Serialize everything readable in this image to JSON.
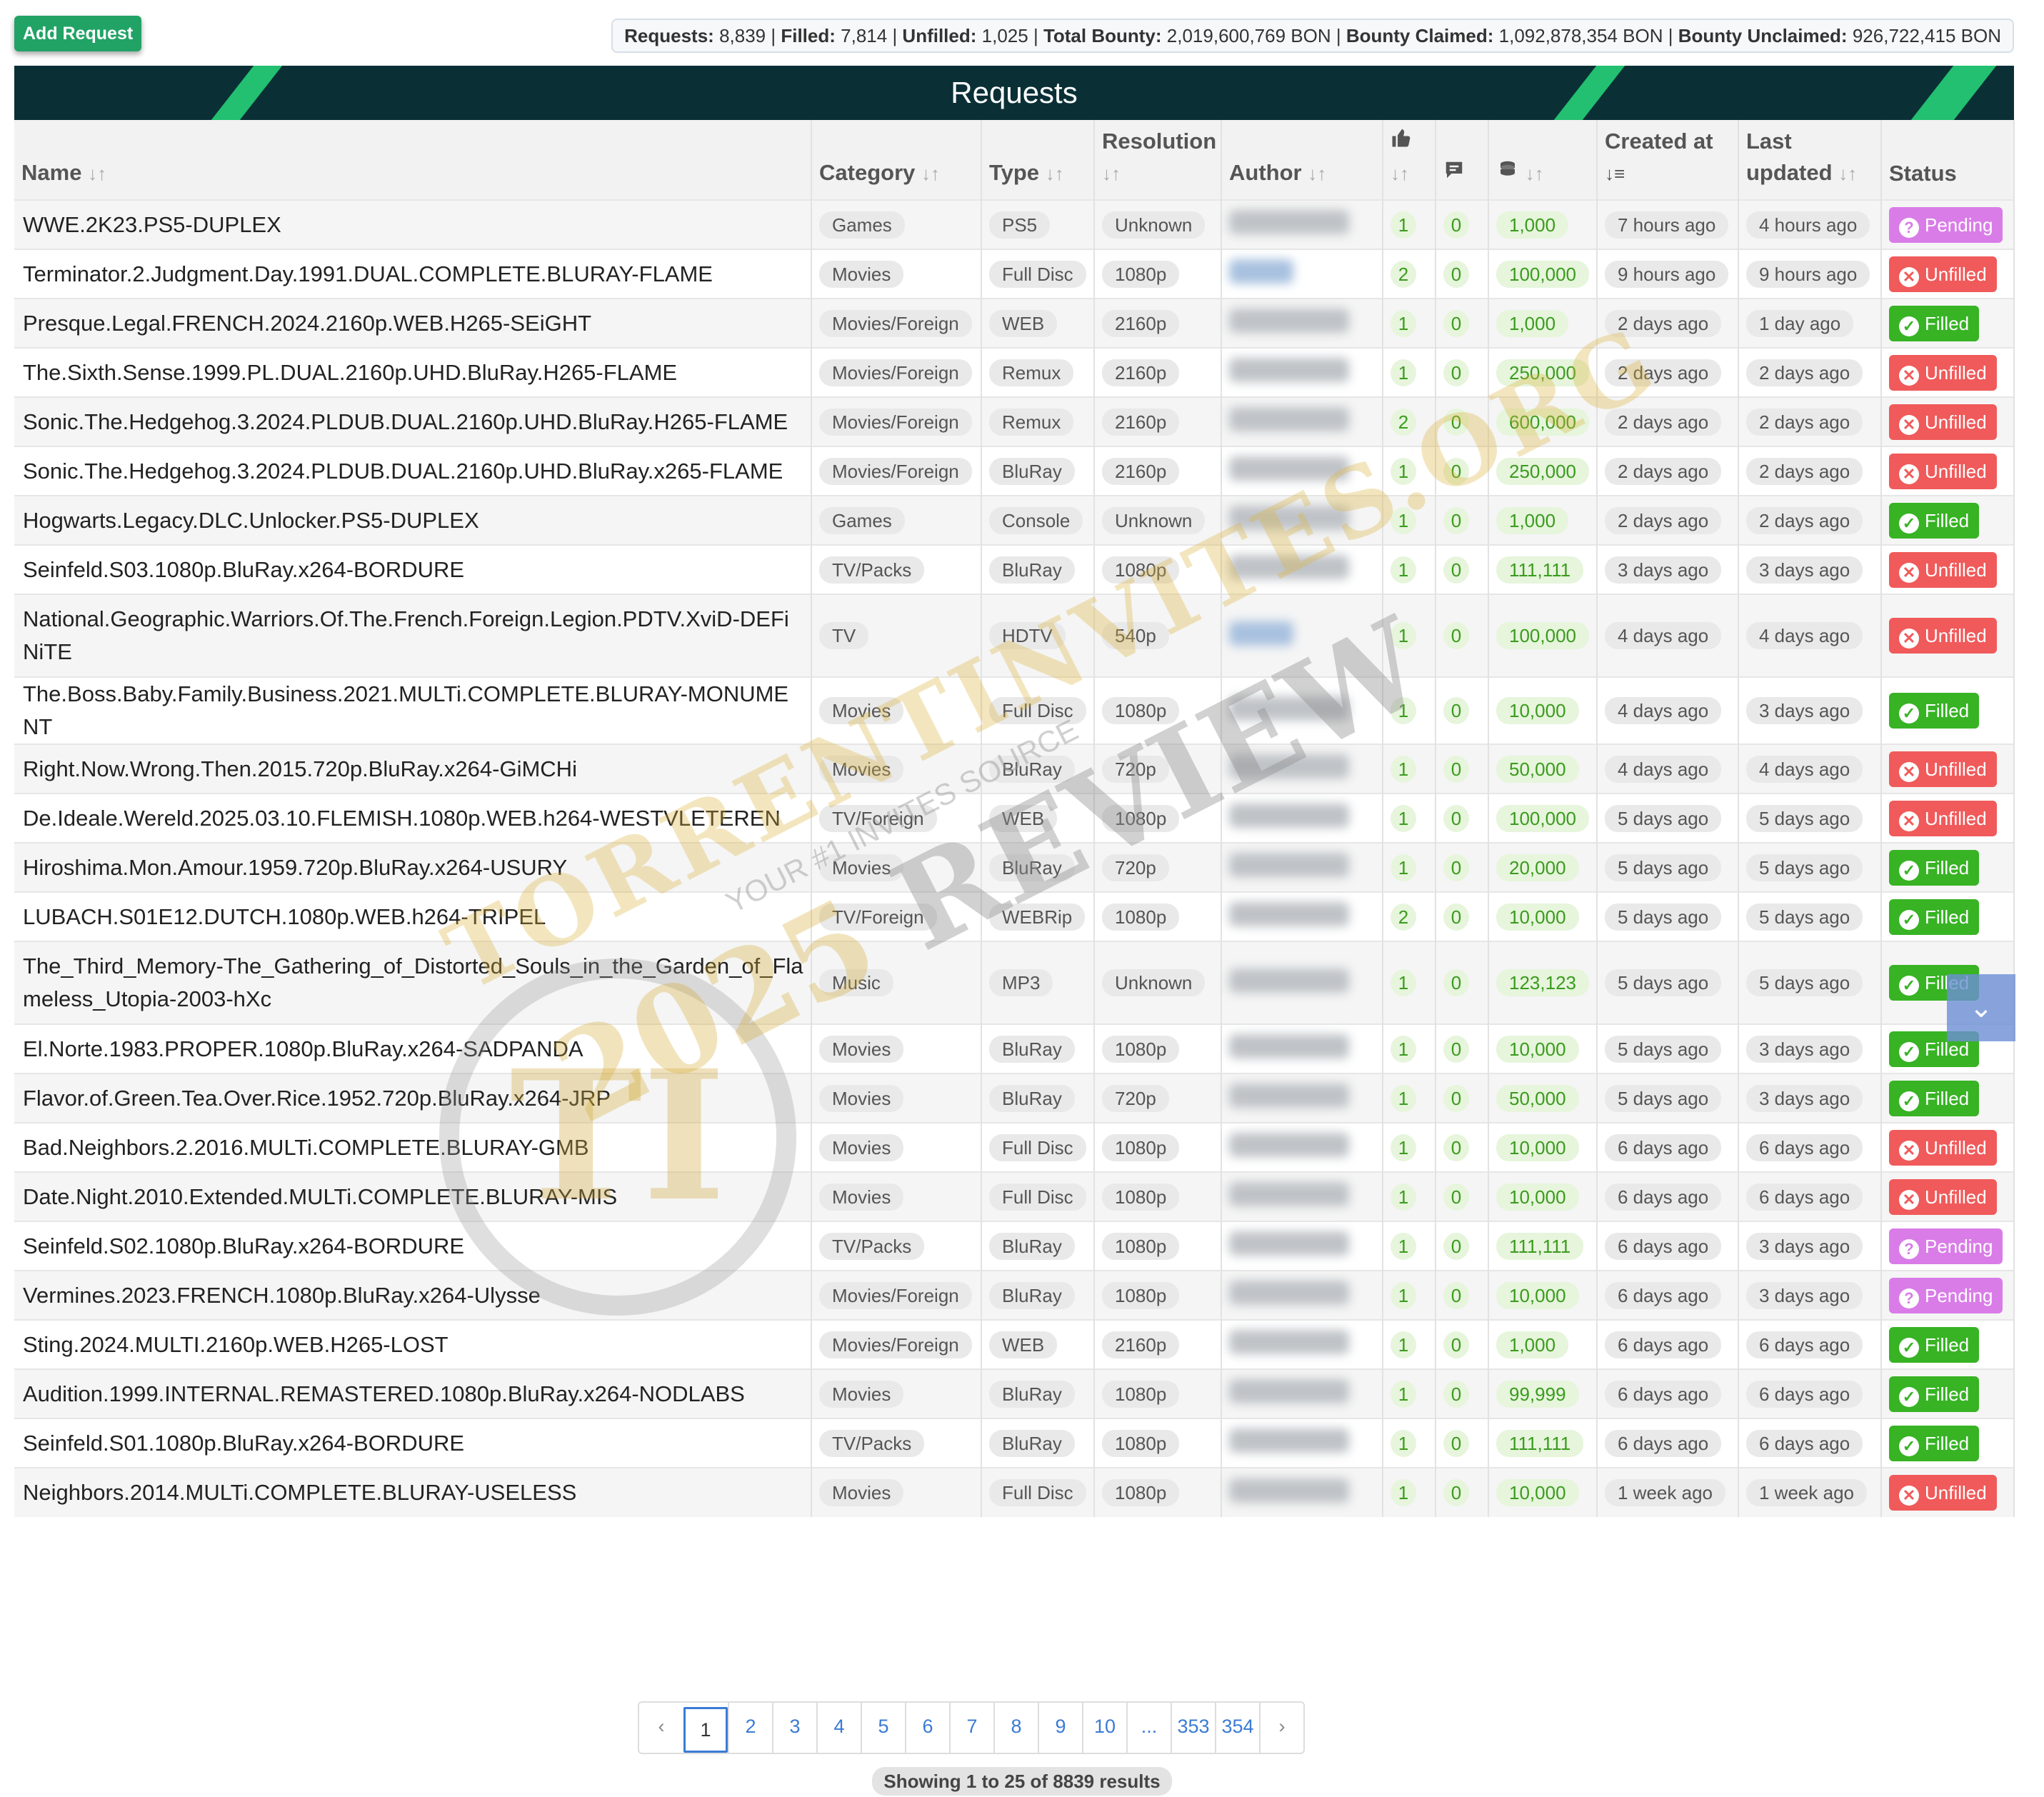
{
  "add_button": "Add Request",
  "stats": [
    {
      "label": "Requests:",
      "value": "8,839"
    },
    {
      "label": "Filled:",
      "value": "7,814"
    },
    {
      "label": "Unfilled:",
      "value": "1,025"
    },
    {
      "label": "Total Bounty:",
      "value": "2,019,600,769 BON"
    },
    {
      "label": "Bounty Claimed:",
      "value": "1,092,878,354 BON"
    },
    {
      "label": "Bounty Unclaimed:",
      "value": "926,722,415 BON"
    }
  ],
  "page_title": "Requests",
  "columns": {
    "name": "Name",
    "category": "Category",
    "type": "Type",
    "resolution": "Resolution",
    "author": "Author",
    "created": "Created at",
    "updated": "Last updated",
    "status": "Status"
  },
  "rows": [
    {
      "name": "WWE.2K23.PS5-DUPLEX",
      "category": "Games",
      "type": "PS5",
      "resolution": "Unknown",
      "votes": "1",
      "comments": "0",
      "bounty": "1,000",
      "created": "7 hours ago",
      "updated": "4 hours ago",
      "status": "Pending"
    },
    {
      "name": "Terminator.2.Judgment.Day.1991.DUAL.COMPLETE.BLURAY-FLAME",
      "category": "Movies",
      "type": "Full Disc",
      "resolution": "1080p",
      "votes": "2",
      "comments": "0",
      "bounty": "100,000",
      "created": "9 hours ago",
      "updated": "9 hours ago",
      "status": "Unfilled",
      "author_link": true
    },
    {
      "name": "Presque.Legal.FRENCH.2024.2160p.WEB.H265-SEiGHT",
      "category": "Movies/Foreign",
      "type": "WEB",
      "resolution": "2160p",
      "votes": "1",
      "comments": "0",
      "bounty": "1,000",
      "created": "2 days ago",
      "updated": "1 day ago",
      "status": "Filled"
    },
    {
      "name": "The.Sixth.Sense.1999.PL.DUAL.2160p.UHD.BluRay.H265-FLAME",
      "category": "Movies/Foreign",
      "type": "Remux",
      "resolution": "2160p",
      "votes": "1",
      "comments": "0",
      "bounty": "250,000",
      "created": "2 days ago",
      "updated": "2 days ago",
      "status": "Unfilled"
    },
    {
      "name": "Sonic.The.Hedgehog.3.2024.PLDUB.DUAL.2160p.UHD.BluRay.H265-FLAME",
      "category": "Movies/Foreign",
      "type": "Remux",
      "resolution": "2160p",
      "votes": "2",
      "comments": "0",
      "bounty": "600,000",
      "created": "2 days ago",
      "updated": "2 days ago",
      "status": "Unfilled"
    },
    {
      "name": "Sonic.The.Hedgehog.3.2024.PLDUB.DUAL.2160p.UHD.BluRay.x265-FLAME",
      "category": "Movies/Foreign",
      "type": "BluRay",
      "resolution": "2160p",
      "votes": "1",
      "comments": "0",
      "bounty": "250,000",
      "created": "2 days ago",
      "updated": "2 days ago",
      "status": "Unfilled"
    },
    {
      "name": "Hogwarts.Legacy.DLC.Unlocker.PS5-DUPLEX",
      "category": "Games",
      "type": "Console",
      "resolution": "Unknown",
      "votes": "1",
      "comments": "0",
      "bounty": "1,000",
      "created": "2 days ago",
      "updated": "2 days ago",
      "status": "Filled"
    },
    {
      "name": "Seinfeld.S03.1080p.BluRay.x264-BORDURE",
      "category": "TV/Packs",
      "type": "BluRay",
      "resolution": "1080p",
      "votes": "1",
      "comments": "0",
      "bounty": "111,111",
      "created": "3 days ago",
      "updated": "3 days ago",
      "status": "Unfilled"
    },
    {
      "name": "National.Geographic.Warriors.Of.The.French.Foreign.Legion.PDTV.XviD-DEFiNiTE",
      "category": "TV",
      "type": "HDTV",
      "resolution": "540p",
      "votes": "1",
      "comments": "0",
      "bounty": "100,000",
      "created": "4 days ago",
      "updated": "4 days ago",
      "status": "Unfilled",
      "author_link": true
    },
    {
      "name": "The.Boss.Baby.Family.Business.2021.MULTi.COMPLETE.BLURAY-MONUMENT",
      "category": "Movies",
      "type": "Full Disc",
      "resolution": "1080p",
      "votes": "1",
      "comments": "0",
      "bounty": "10,000",
      "created": "4 days ago",
      "updated": "3 days ago",
      "status": "Filled"
    },
    {
      "name": "Right.Now.Wrong.Then.2015.720p.BluRay.x264-GiMCHi",
      "category": "Movies",
      "type": "BluRay",
      "resolution": "720p",
      "votes": "1",
      "comments": "0",
      "bounty": "50,000",
      "created": "4 days ago",
      "updated": "4 days ago",
      "status": "Unfilled"
    },
    {
      "name": "De.Ideale.Wereld.2025.03.10.FLEMISH.1080p.WEB.h264-WESTVLETEREN",
      "category": "TV/Foreign",
      "type": "WEB",
      "resolution": "1080p",
      "votes": "1",
      "comments": "0",
      "bounty": "100,000",
      "created": "5 days ago",
      "updated": "5 days ago",
      "status": "Unfilled"
    },
    {
      "name": "Hiroshima.Mon.Amour.1959.720p.BluRay.x264-USURY",
      "category": "Movies",
      "type": "BluRay",
      "resolution": "720p",
      "votes": "1",
      "comments": "0",
      "bounty": "20,000",
      "created": "5 days ago",
      "updated": "5 days ago",
      "status": "Filled"
    },
    {
      "name": "LUBACH.S01E12.DUTCH.1080p.WEB.h264-TRIPEL",
      "category": "TV/Foreign",
      "type": "WEBRip",
      "resolution": "1080p",
      "votes": "2",
      "comments": "0",
      "bounty": "10,000",
      "created": "5 days ago",
      "updated": "5 days ago",
      "status": "Filled"
    },
    {
      "name": "The_Third_Memory-The_Gathering_of_Distorted_Souls_in_the_Garden_of_Flameless_Utopia-2003-hXc",
      "category": "Music",
      "type": "MP3",
      "resolution": "Unknown",
      "votes": "1",
      "comments": "0",
      "bounty": "123,123",
      "created": "5 days ago",
      "updated": "5 days ago",
      "status": "Filled"
    },
    {
      "name": "El.Norte.1983.PROPER.1080p.BluRay.x264-SADPANDA",
      "category": "Movies",
      "type": "BluRay",
      "resolution": "1080p",
      "votes": "1",
      "comments": "0",
      "bounty": "10,000",
      "created": "5 days ago",
      "updated": "3 days ago",
      "status": "Filled"
    },
    {
      "name": "Flavor.of.Green.Tea.Over.Rice.1952.720p.BluRay.x264-JRP",
      "category": "Movies",
      "type": "BluRay",
      "resolution": "720p",
      "votes": "1",
      "comments": "0",
      "bounty": "50,000",
      "created": "5 days ago",
      "updated": "3 days ago",
      "status": "Filled"
    },
    {
      "name": "Bad.Neighbors.2.2016.MULTi.COMPLETE.BLURAY-GMB",
      "category": "Movies",
      "type": "Full Disc",
      "resolution": "1080p",
      "votes": "1",
      "comments": "0",
      "bounty": "10,000",
      "created": "6 days ago",
      "updated": "6 days ago",
      "status": "Unfilled"
    },
    {
      "name": "Date.Night.2010.Extended.MULTi.COMPLETE.BLURAY-MIS",
      "category": "Movies",
      "type": "Full Disc",
      "resolution": "1080p",
      "votes": "1",
      "comments": "0",
      "bounty": "10,000",
      "created": "6 days ago",
      "updated": "6 days ago",
      "status": "Unfilled"
    },
    {
      "name": "Seinfeld.S02.1080p.BluRay.x264-BORDURE",
      "category": "TV/Packs",
      "type": "BluRay",
      "resolution": "1080p",
      "votes": "1",
      "comments": "0",
      "bounty": "111,111",
      "created": "6 days ago",
      "updated": "3 days ago",
      "status": "Pending"
    },
    {
      "name": "Vermines.2023.FRENCH.1080p.BluRay.x264-Ulysse",
      "category": "Movies/Foreign",
      "type": "BluRay",
      "resolution": "1080p",
      "votes": "1",
      "comments": "0",
      "bounty": "10,000",
      "created": "6 days ago",
      "updated": "3 days ago",
      "status": "Pending"
    },
    {
      "name": "Sting.2024.MULTI.2160p.WEB.H265-LOST",
      "category": "Movies/Foreign",
      "type": "WEB",
      "resolution": "2160p",
      "votes": "1",
      "comments": "0",
      "bounty": "1,000",
      "created": "6 days ago",
      "updated": "6 days ago",
      "status": "Filled"
    },
    {
      "name": "Audition.1999.INTERNAL.REMASTERED.1080p.BluRay.x264-NODLABS",
      "category": "Movies",
      "type": "BluRay",
      "resolution": "1080p",
      "votes": "1",
      "comments": "0",
      "bounty": "99,999",
      "created": "6 days ago",
      "updated": "6 days ago",
      "status": "Filled"
    },
    {
      "name": "Seinfeld.S01.1080p.BluRay.x264-BORDURE",
      "category": "TV/Packs",
      "type": "BluRay",
      "resolution": "1080p",
      "votes": "1",
      "comments": "0",
      "bounty": "111,111",
      "created": "6 days ago",
      "updated": "6 days ago",
      "status": "Filled"
    },
    {
      "name": "Neighbors.2014.MULTi.COMPLETE.BLURAY-USELESS",
      "category": "Movies",
      "type": "Full Disc",
      "resolution": "1080p",
      "votes": "1",
      "comments": "0",
      "bounty": "10,000",
      "created": "1 week ago",
      "updated": "1 week ago",
      "status": "Unfilled"
    }
  ],
  "pagination": {
    "prev": "‹",
    "pages": [
      "1",
      "2",
      "3",
      "4",
      "5",
      "6",
      "7",
      "8",
      "9",
      "10",
      "...",
      "353",
      "354"
    ],
    "active": "1",
    "next": "›"
  },
  "showing": "Showing 1 to 25 of 8839 results",
  "watermark": {
    "line1": "TORRENTINVITES.ORG",
    "line2": "YOUR #1 INVITES SOURCE",
    "line3a": "2025",
    "line3b": "REVIEW",
    "badge": "TI"
  },
  "colors": {
    "banner": "#0a3036",
    "accent_green": "#22c070",
    "pending": "#d97ce8",
    "unfilled": "#f05a5a",
    "filled": "#37b324",
    "bounty_green": "#3b9b1e"
  },
  "icons": {
    "votes": "thumbs-up-icon",
    "comments": "comment-icon",
    "bounty": "coins-icon",
    "sort": "sort-icon",
    "scroll": "scroll-top-icon"
  }
}
